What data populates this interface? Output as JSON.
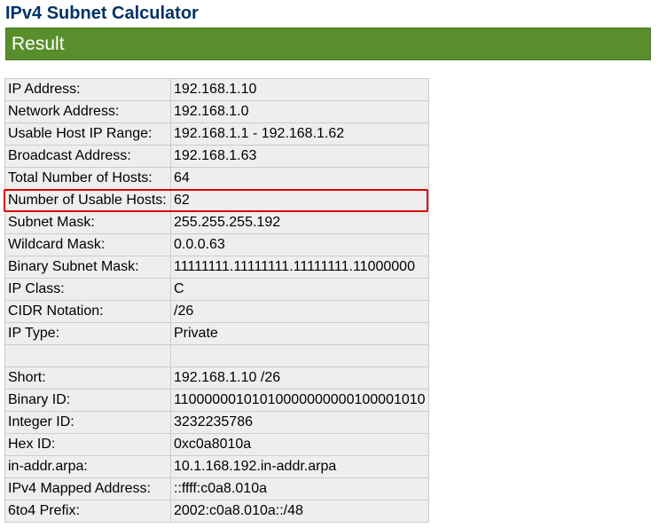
{
  "page": {
    "title": "IPv4 Subnet Calculator",
    "section_header": "Result"
  },
  "colors": {
    "header_bg": "#588e2b",
    "title_text": "#003366",
    "table_bg": "#eeeeee",
    "highlight": "#e00000"
  },
  "result": {
    "rows": [
      {
        "label": "IP Address:",
        "value": "192.168.1.10"
      },
      {
        "label": "Network Address:",
        "value": "192.168.1.0"
      },
      {
        "label": "Usable Host IP Range:",
        "value": "192.168.1.1 - 192.168.1.62"
      },
      {
        "label": "Broadcast Address:",
        "value": "192.168.1.63"
      },
      {
        "label": "Total Number of Hosts:",
        "value": "64"
      },
      {
        "label": "Number of Usable Hosts:",
        "value": "62"
      },
      {
        "label": "Subnet Mask:",
        "value": "255.255.255.192"
      },
      {
        "label": "Wildcard Mask:",
        "value": "0.0.0.63"
      },
      {
        "label": "Binary Subnet Mask:",
        "value": "11111111.11111111.11111111.11000000"
      },
      {
        "label": "IP Class:",
        "value": "C"
      },
      {
        "label": "CIDR Notation:",
        "value": "/26"
      },
      {
        "label": "IP Type:",
        "value": "Private"
      },
      {
        "label": "",
        "value": ""
      },
      {
        "label": "Short:",
        "value": "192.168.1.10 /26"
      },
      {
        "label": "Binary ID:",
        "value": "11000000101010000000000100001010"
      },
      {
        "label": "Integer ID:",
        "value": "3232235786"
      },
      {
        "label": "Hex ID:",
        "value": "0xc0a8010a"
      },
      {
        "label": "in-addr.arpa:",
        "value": "10.1.168.192.in-addr.arpa"
      },
      {
        "label": "IPv4 Mapped Address:",
        "value": "::ffff:c0a8.010a"
      },
      {
        "label": "6to4 Prefix:",
        "value": "2002:c0a8.010a::/48"
      }
    ]
  }
}
